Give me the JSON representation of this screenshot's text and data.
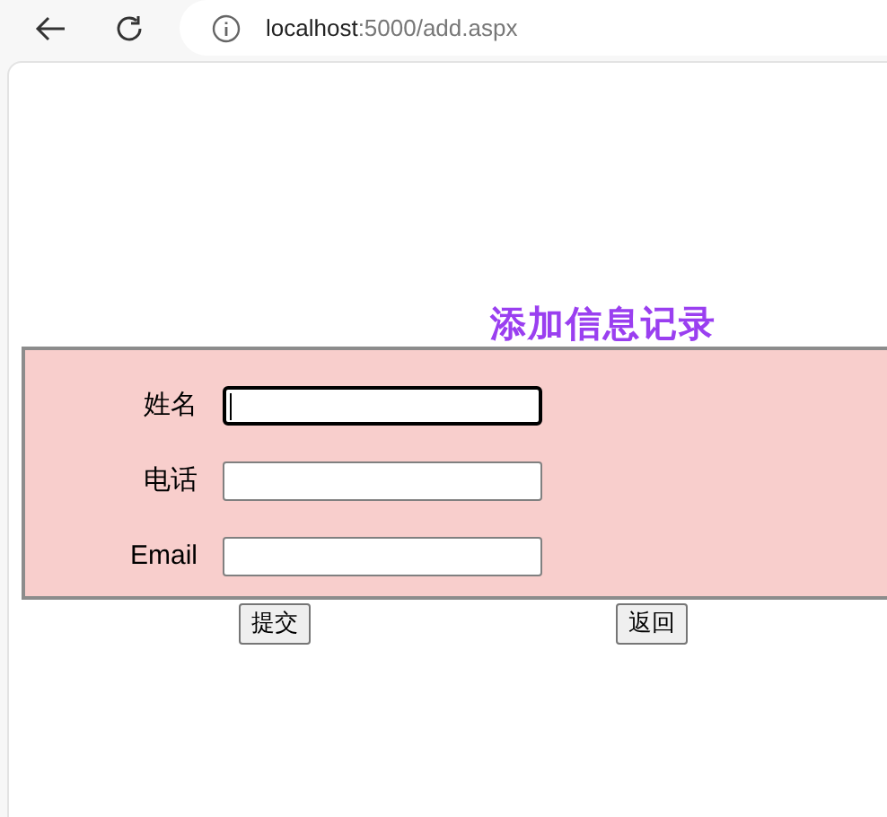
{
  "browser": {
    "url_host": "localhost",
    "url_rest": ":5000/add.aspx"
  },
  "heading": "添加信息记录",
  "fields": [
    {
      "label": "姓名",
      "focused": true
    },
    {
      "label": "电话",
      "focused": false
    },
    {
      "label": "Email",
      "focused": false
    }
  ],
  "buttons": [
    "提交",
    "返回"
  ]
}
